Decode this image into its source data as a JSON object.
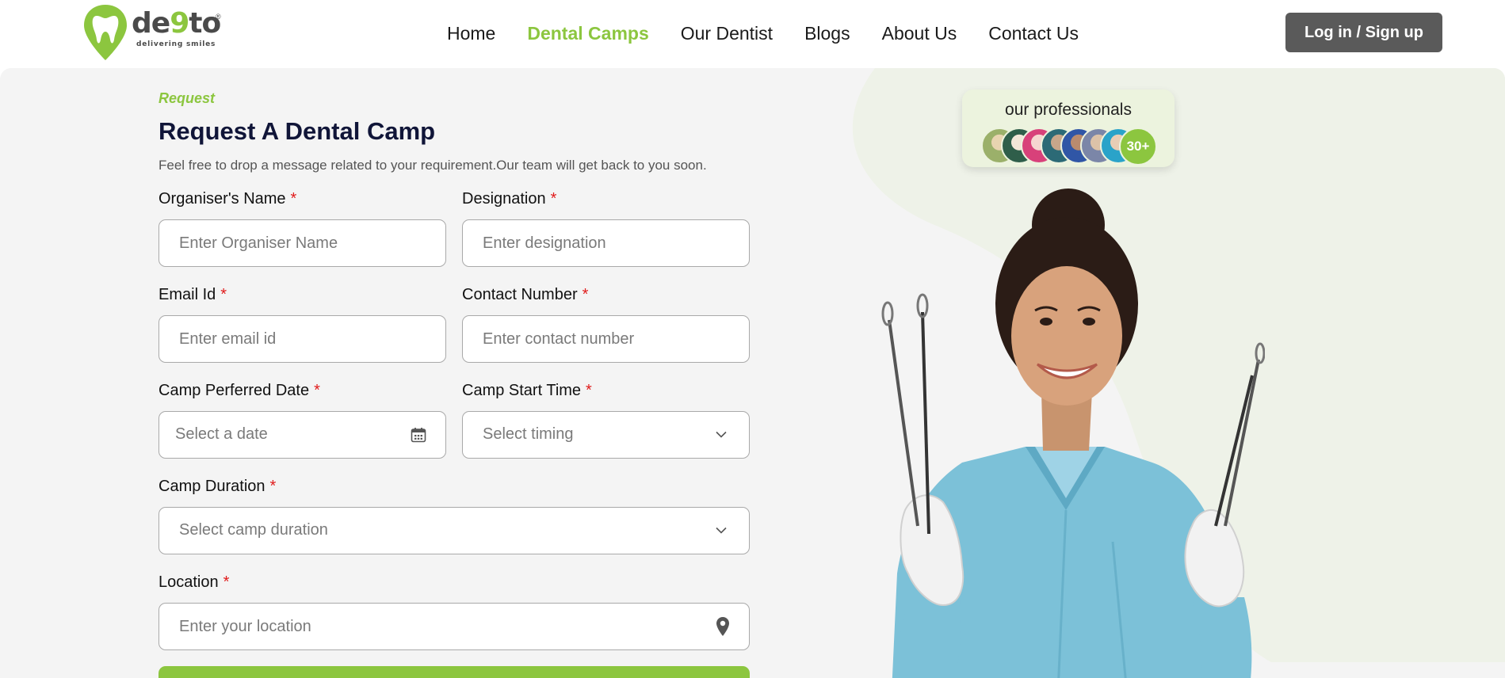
{
  "brand": {
    "name_part1": "de",
    "name_nine": "9",
    "name_part2": "to",
    "registered": "®",
    "tagline": "delivering smiles",
    "accent_color": "#8cc63f"
  },
  "nav": {
    "items": [
      {
        "label": "Home",
        "active": false
      },
      {
        "label": "Dental Camps",
        "active": true
      },
      {
        "label": "Our Dentist",
        "active": false
      },
      {
        "label": "Blogs",
        "active": false
      },
      {
        "label": "About Us",
        "active": false
      },
      {
        "label": "Contact Us",
        "active": false
      }
    ],
    "login_label": "Log in / Sign up"
  },
  "form": {
    "kicker": "Request",
    "title": "Request A Dental Camp",
    "subtitle": "Feel free to drop a message related to your requirement.Our team will get back to you soon.",
    "required_mark": "*",
    "organiser": {
      "label": "Organiser's Name",
      "placeholder": "Enter Organiser Name"
    },
    "designation": {
      "label": "Designation",
      "placeholder": "Enter designation"
    },
    "email": {
      "label": "Email Id",
      "placeholder": "Enter email id"
    },
    "contact": {
      "label": "Contact Number",
      "placeholder": "Enter contact number"
    },
    "date": {
      "label": "Camp Perferred Date",
      "placeholder": "Select a date"
    },
    "start_time": {
      "label": "Camp Start Time",
      "placeholder": "Select timing"
    },
    "duration": {
      "label": "Camp Duration",
      "placeholder": "Select camp duration"
    },
    "location": {
      "label": "Location",
      "placeholder": "Enter your location"
    }
  },
  "professionals": {
    "title": "our professionals",
    "count": "30+"
  },
  "icons": [
    "tooth-pin-logo-icon",
    "calendar-icon",
    "chevron-down-icon",
    "location-pin-icon"
  ]
}
